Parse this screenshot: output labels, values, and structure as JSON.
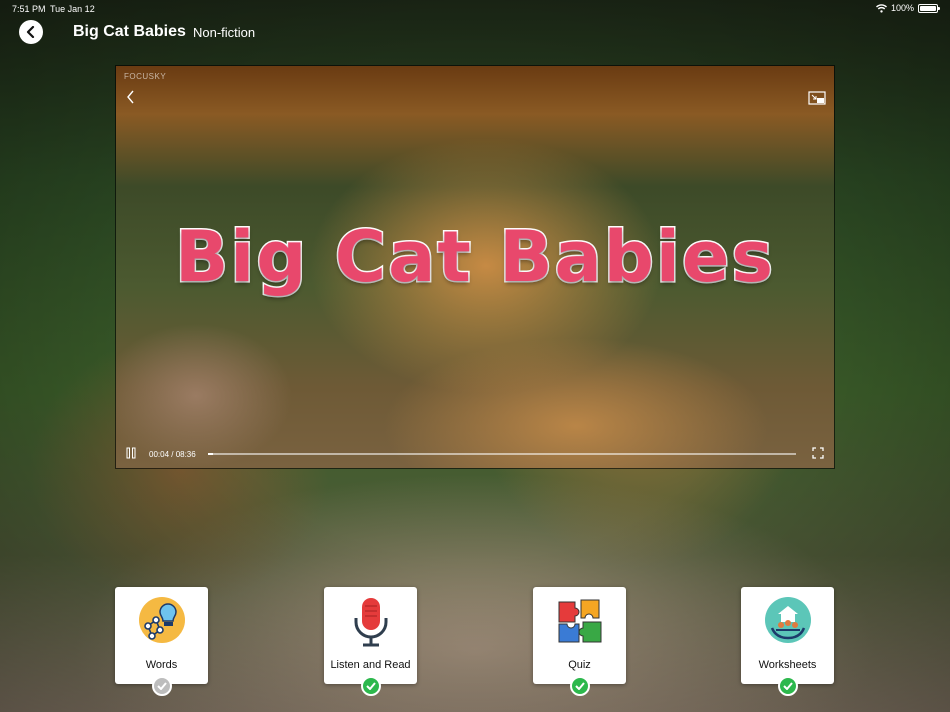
{
  "status_bar": {
    "time": "7:51 PM",
    "date": "Tue Jan 12",
    "battery": "100%"
  },
  "header": {
    "title": "Big Cat Babies",
    "genre": "Non-fiction"
  },
  "video": {
    "watermark": "FOCUSKY",
    "title_overlay": "Big Cat Babies",
    "timecode": "00:04 / 08:36",
    "progress_fraction": 0.008
  },
  "activities": [
    {
      "label": "Words",
      "icon": "words-icon",
      "completed": false
    },
    {
      "label": "Listen and Read",
      "icon": "microphone-icon",
      "completed": true
    },
    {
      "label": "Quiz",
      "icon": "puzzle-icon",
      "completed": true
    },
    {
      "label": "Worksheets",
      "icon": "worksheets-icon",
      "completed": true
    }
  ],
  "colors": {
    "check_done": "#2db84d",
    "check_pending": "#bdbdbd",
    "title_pink": "#e8486c"
  }
}
